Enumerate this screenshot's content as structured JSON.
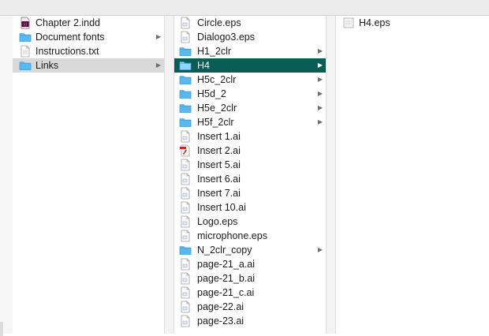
{
  "columns": [
    {
      "items": [
        {
          "label": "Chapter 2.indd",
          "icon": "indesign-file-icon",
          "folder": false
        },
        {
          "label": "Document fonts",
          "icon": "folder-icon",
          "folder": true
        },
        {
          "label": "Instructions.txt",
          "icon": "text-file-icon",
          "folder": false
        },
        {
          "label": "Links",
          "icon": "folder-icon",
          "folder": true,
          "selected": "inactive"
        }
      ]
    },
    {
      "items": [
        {
          "label": "Circle.eps",
          "icon": "eps-file-icon",
          "folder": false
        },
        {
          "label": "Dialogo3.eps",
          "icon": "eps-file-icon",
          "folder": false
        },
        {
          "label": "H1_2clr",
          "icon": "folder-icon",
          "folder": true
        },
        {
          "label": "H4",
          "icon": "folder-icon",
          "folder": true,
          "selected": "active"
        },
        {
          "label": "H5c_2clr",
          "icon": "folder-icon",
          "folder": true
        },
        {
          "label": "H5d_2",
          "icon": "folder-icon",
          "folder": true
        },
        {
          "label": "H5e_2clr",
          "icon": "folder-icon",
          "folder": true
        },
        {
          "label": "H5f_2clr",
          "icon": "folder-icon",
          "folder": true
        },
        {
          "label": "Insert 1.ai",
          "icon": "document-file-icon",
          "folder": false
        },
        {
          "label": "Insert 2.ai",
          "icon": "pdf-file-icon",
          "folder": false
        },
        {
          "label": "Insert 5.ai",
          "icon": "document-file-icon",
          "folder": false
        },
        {
          "label": "Insert 6.ai",
          "icon": "document-file-icon",
          "folder": false
        },
        {
          "label": "Insert 7.ai",
          "icon": "document-file-icon",
          "folder": false
        },
        {
          "label": "Insert 10.ai",
          "icon": "document-file-icon",
          "folder": false
        },
        {
          "label": "Logo.eps",
          "icon": "eps-file-icon",
          "folder": false
        },
        {
          "label": "microphone.eps",
          "icon": "eps-file-icon",
          "folder": false
        },
        {
          "label": "N_2clr_copy",
          "icon": "folder-icon",
          "folder": true
        },
        {
          "label": "page-21_a.ai",
          "icon": "document-file-icon",
          "folder": false
        },
        {
          "label": "page-21_b.ai",
          "icon": "document-file-icon",
          "folder": false
        },
        {
          "label": "page-21_c.ai",
          "icon": "document-file-icon",
          "folder": false
        },
        {
          "label": "page-22.ai",
          "icon": "document-file-icon",
          "folder": false
        },
        {
          "label": "page-23.ai",
          "icon": "document-file-icon",
          "folder": false
        }
      ]
    },
    {
      "items": [
        {
          "label": "H4.eps",
          "icon": "eps-preview-icon",
          "folder": false
        }
      ]
    }
  ],
  "colors": {
    "selection_active": "#0b5c55",
    "selection_inactive": "#d9d9d9",
    "folder": "#5ab8ef",
    "indesign": "#4b0f3a"
  }
}
